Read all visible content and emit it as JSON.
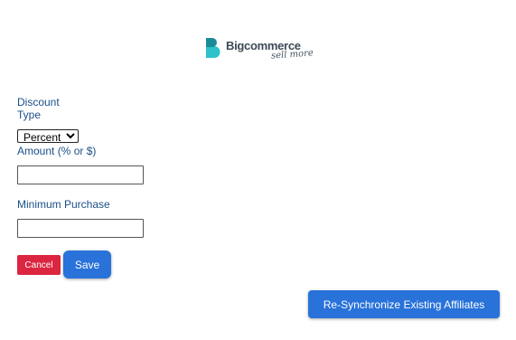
{
  "logo": {
    "wordmark": "Bigcommerce",
    "tagline": "sell more",
    "icon": "bigcommerce-b-logo-icon",
    "colors": {
      "mark_dark": "#1a8b97",
      "mark_light": "#2dc2c9",
      "text": "#3c4a57"
    }
  },
  "form": {
    "discount_type": {
      "label": "Discount Type",
      "selected": "Percent"
    },
    "amount": {
      "label": "Amount (% or $)",
      "value": ""
    },
    "minimum_purchase": {
      "label": "Minimum Purchase",
      "value": ""
    },
    "cancel_label": "Cancel",
    "save_label": "Save"
  },
  "resync_label": "Re-Synchronize Existing Affiliates",
  "colors": {
    "label": "#1b4f88",
    "primary_button": "#2872d9",
    "cancel_button": "#dc2540"
  }
}
